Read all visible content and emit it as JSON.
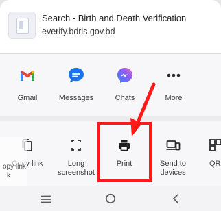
{
  "header": {
    "title": "Search - Birth and Death Verification",
    "url": "everify.bdris.gov.bd"
  },
  "apps": [
    {
      "label": "Gmail",
      "icon": "gmail-icon"
    },
    {
      "label": "Messages",
      "icon": "messages-icon"
    },
    {
      "label": "Chats",
      "icon": "messenger-icon"
    },
    {
      "label": "More",
      "icon": "more-dots-icon"
    }
  ],
  "actions": [
    {
      "label": "Copy link",
      "icon": "copy-icon"
    },
    {
      "label": "Long screenshot",
      "icon": "long-screenshot-icon"
    },
    {
      "label": "Print",
      "icon": "print-icon"
    },
    {
      "label": "Send to devices",
      "icon": "send-to-devices-icon"
    },
    {
      "label": "QR c",
      "icon": "qr-code-icon"
    }
  ],
  "ghost_labels": [
    "opy link",
    "k"
  ],
  "nav": {
    "icons": [
      "recent-apps-icon",
      "home-icon",
      "back-icon"
    ]
  },
  "colors": {
    "annotation": "#ff1a1a",
    "gmail_red": "#ea4335",
    "messages_blue": "#1a73e8",
    "messenger_purple": "#8b5cf6"
  }
}
